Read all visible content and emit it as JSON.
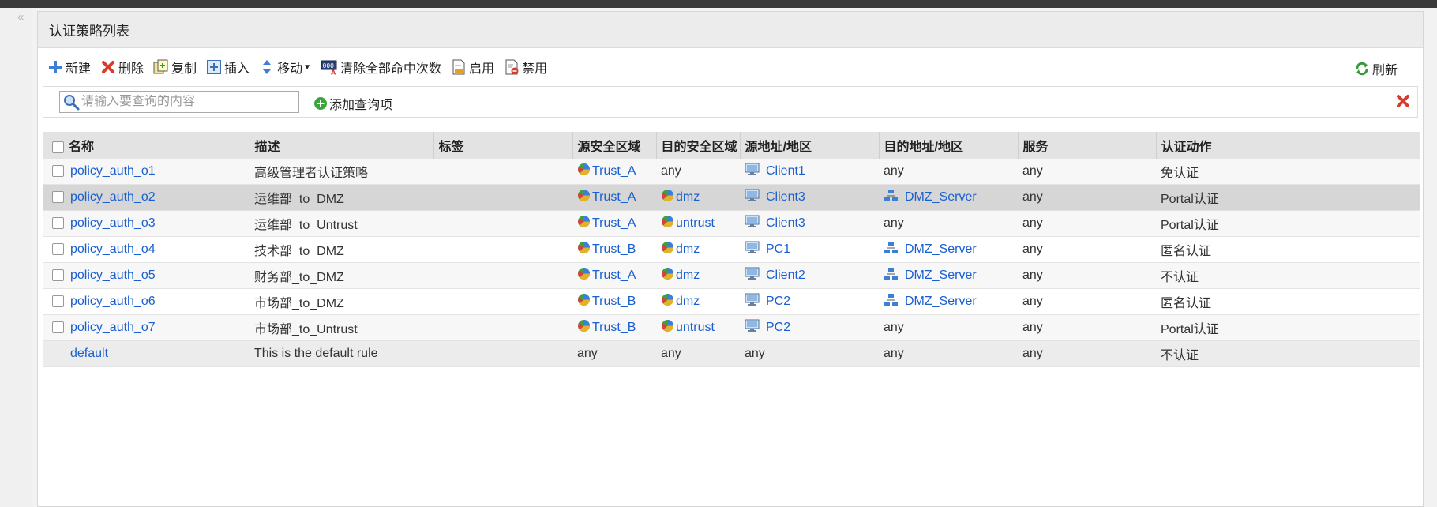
{
  "panel": {
    "title": "认证策略列表"
  },
  "toolbar": {
    "new_label": "新建",
    "delete_label": "删除",
    "copy_label": "复制",
    "insert_label": "插入",
    "move_label": "移动",
    "clear_hits_label": "清除全部命中次数",
    "enable_label": "启用",
    "disable_label": "禁用",
    "refresh_label": "刷新"
  },
  "search": {
    "placeholder": "请输入要查询的内容",
    "add_query_label": "添加查询项"
  },
  "table": {
    "columns": [
      "名称",
      "描述",
      "标签",
      "源安全区域",
      "目的安全区域",
      "源地址/地区",
      "目的地址/地区",
      "服务",
      "认证动作"
    ],
    "rows": [
      {
        "name": "policy_auth_o1",
        "desc": "高级管理者认证策略",
        "tag": "",
        "src_zone": "Trust_A",
        "dst_zone": "any",
        "src_addr": "Client1",
        "dst_addr": "any",
        "service": "any",
        "action": "免认证",
        "selected": false
      },
      {
        "name": "policy_auth_o2",
        "desc": "运维部_to_DMZ",
        "tag": "",
        "src_zone": "Trust_A",
        "dst_zone": "dmz",
        "src_addr": "Client3",
        "dst_addr": "DMZ_Server",
        "service": "any",
        "action": "Portal认证",
        "selected": true
      },
      {
        "name": "policy_auth_o3",
        "desc": "运维部_to_Untrust",
        "tag": "",
        "src_zone": "Trust_A",
        "dst_zone": "untrust",
        "src_addr": "Client3",
        "dst_addr": "any",
        "service": "any",
        "action": "Portal认证",
        "selected": false
      },
      {
        "name": "policy_auth_o4",
        "desc": "技术部_to_DMZ",
        "tag": "",
        "src_zone": "Trust_B",
        "dst_zone": "dmz",
        "src_addr": "PC1",
        "dst_addr": "DMZ_Server",
        "service": "any",
        "action": "匿名认证",
        "selected": false
      },
      {
        "name": "policy_auth_o5",
        "desc": "财务部_to_DMZ",
        "tag": "",
        "src_zone": "Trust_A",
        "dst_zone": "dmz",
        "src_addr": "Client2",
        "dst_addr": "DMZ_Server",
        "service": "any",
        "action": "不认证",
        "selected": false
      },
      {
        "name": "policy_auth_o6",
        "desc": "市场部_to_DMZ",
        "tag": "",
        "src_zone": "Trust_B",
        "dst_zone": "dmz",
        "src_addr": "PC2",
        "dst_addr": "DMZ_Server",
        "service": "any",
        "action": "匿名认证",
        "selected": false
      },
      {
        "name": "policy_auth_o7",
        "desc": "市场部_to_Untrust",
        "tag": "",
        "src_zone": "Trust_B",
        "dst_zone": "untrust",
        "src_addr": "PC2",
        "dst_addr": "any",
        "service": "any",
        "action": "Portal认证",
        "selected": false
      }
    ],
    "default_row": {
      "name": "default",
      "desc": "This is the default rule",
      "tag": "",
      "src_zone": "any",
      "dst_zone": "any",
      "src_addr": "any",
      "dst_addr": "any",
      "service": "any",
      "action": "不认证"
    }
  },
  "colors": {
    "link": "#1a5fd0",
    "selected_row": "#d6d6d6",
    "header_bg": "#e3e3e3",
    "topbar": "#3a3a3a"
  }
}
